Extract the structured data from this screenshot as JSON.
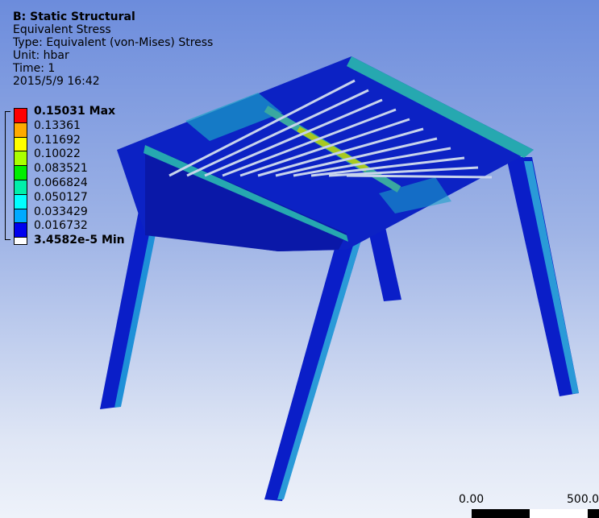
{
  "header": {
    "title": "B: Static Structural",
    "result": "Equivalent Stress",
    "type": "Type: Equivalent (von-Mises) Stress",
    "unit": "Unit: hbar",
    "time": "Time: 1",
    "date": "2015/5/9 16:42"
  },
  "legend": {
    "labels": [
      "0.15031 Max",
      "0.13361",
      "0.11692",
      "0.10022",
      "0.083521",
      "0.066824",
      "0.050127",
      "0.033429",
      "0.016732",
      "3.4582e-5 Min"
    ],
    "colors": [
      "#ff0000",
      "#ffaa00",
      "#ffff00",
      "#aaff00",
      "#00ee00",
      "#00eeaa",
      "#00ffff",
      "#00aaff",
      "#0000ee",
      "#ffffff"
    ]
  },
  "scale": {
    "start": "0.00",
    "end": "500.0"
  }
}
